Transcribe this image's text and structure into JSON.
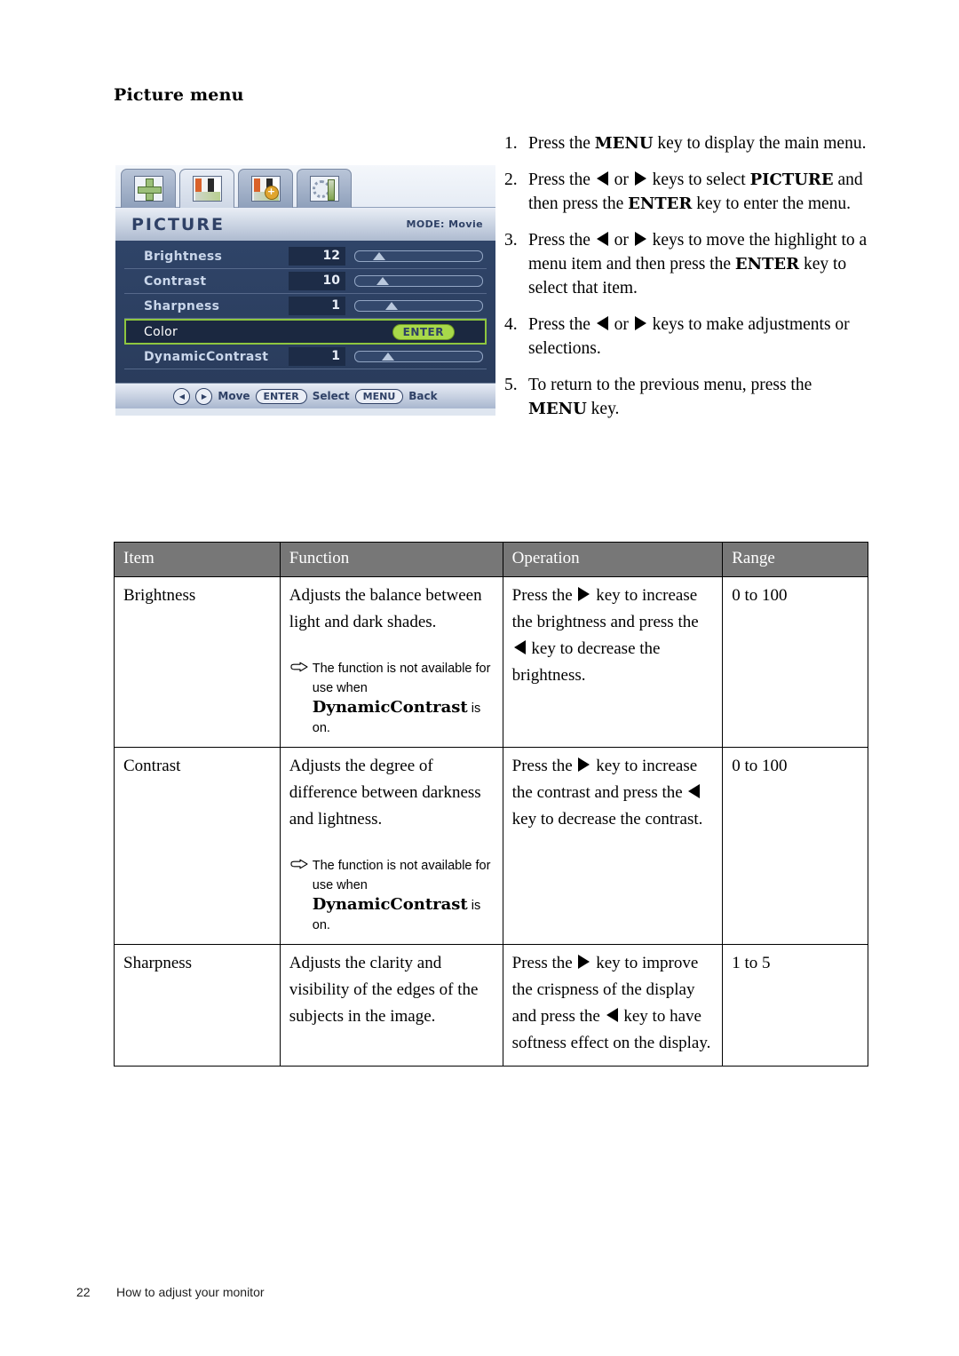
{
  "page": {
    "heading": "Picture menu",
    "footer_page_number": "22",
    "footer_text": "How to adjust your monitor"
  },
  "osd": {
    "tabs": [
      {
        "name": "display-position-tab",
        "icon": "four-way-arrows-icon"
      },
      {
        "name": "picture-tab",
        "icon": "color-bars-icon"
      },
      {
        "name": "picture-advanced-tab",
        "icon": "color-bars-plus-icon"
      },
      {
        "name": "system-tab",
        "icon": "gear-screwdriver-icon"
      }
    ],
    "title": "PICTURE",
    "mode_label": "MODE: Movie",
    "rows": [
      {
        "label": "Brightness",
        "value": "12",
        "slider_pct": 14,
        "type": "slider"
      },
      {
        "label": "Contrast",
        "value": "10",
        "slider_pct": 17,
        "type": "slider"
      },
      {
        "label": "Sharpness",
        "value": "1",
        "slider_pct": 24,
        "type": "slider"
      },
      {
        "label": "Color",
        "value": "",
        "type": "enter",
        "button_label": "ENTER",
        "highlighted": true
      },
      {
        "label": "DynamicContrast",
        "value": "1",
        "slider_pct": 21,
        "type": "slider"
      }
    ],
    "footer": {
      "move_label": "Move",
      "enter_label": "ENTER",
      "select_label": "Select",
      "menu_label": "MENU",
      "back_label": "Back"
    },
    "colors": {
      "highlight_green": "#8ec63f",
      "enter_pill": "#a8d94a",
      "body_blue": "#2f4468"
    }
  },
  "steps": [
    {
      "num": "1.",
      "parts": [
        {
          "t": "Press the "
        },
        {
          "t": "MENU",
          "b": true
        },
        {
          "t": " key to display the main menu."
        }
      ]
    },
    {
      "num": "2.",
      "parts": [
        {
          "t": "Press the "
        },
        {
          "icon": "left-arrow-icon"
        },
        {
          "t": " or "
        },
        {
          "icon": "right-arrow-icon"
        },
        {
          "t": " keys to select "
        },
        {
          "t": "PICTURE",
          "b": true
        },
        {
          "t": " and then press the "
        },
        {
          "t": "ENTER",
          "b": true
        },
        {
          "t": " key to enter the menu."
        }
      ]
    },
    {
      "num": "3.",
      "parts": [
        {
          "t": "Press the "
        },
        {
          "icon": "left-arrow-icon"
        },
        {
          "t": " or "
        },
        {
          "icon": "right-arrow-icon"
        },
        {
          "t": " keys to move the highlight to a menu item and then press the "
        },
        {
          "t": "ENTER",
          "b": true
        },
        {
          "t": " key to select that item."
        }
      ]
    },
    {
      "num": "4.",
      "parts": [
        {
          "t": "Press the "
        },
        {
          "icon": "left-arrow-icon"
        },
        {
          "t": " or "
        },
        {
          "icon": "right-arrow-icon"
        },
        {
          "t": " keys to make adjustments or selections."
        }
      ]
    },
    {
      "num": "5.",
      "parts": [
        {
          "t": "To return to the previous menu, press the "
        },
        {
          "t": "MENU",
          "b": true
        },
        {
          "t": " key."
        }
      ]
    }
  ],
  "table": {
    "headers": [
      "Item",
      "Function",
      "Operation",
      "Range"
    ],
    "rows": [
      {
        "item": "Brightness",
        "function": "Adjusts the balance between light and dark shades.",
        "note": {
          "icon": "pointing-hand-icon",
          "parts": [
            {
              "t": "The function is not available for use when "
            },
            {
              "t": "DynamicContrast",
              "b": true
            },
            {
              "t": " is on."
            }
          ]
        },
        "operation_parts": [
          {
            "t": "Press the "
          },
          {
            "icon": "right-arrow-icon"
          },
          {
            "t": " key to increase the brightness and press the "
          },
          {
            "icon": "left-arrow-icon"
          },
          {
            "t": " key to decrease the brightness."
          }
        ],
        "range": "0 to 100"
      },
      {
        "item": "Contrast",
        "function": "Adjusts the degree of difference between darkness and lightness.",
        "note": {
          "icon": "pointing-hand-icon",
          "parts": [
            {
              "t": "The function is not available for use when "
            },
            {
              "t": "DynamicContrast",
              "b": true
            },
            {
              "t": " is on."
            }
          ]
        },
        "operation_parts": [
          {
            "t": "Press the "
          },
          {
            "icon": "right-arrow-icon"
          },
          {
            "t": " key to increase the contrast and press the "
          },
          {
            "icon": "left-arrow-icon"
          },
          {
            "t": " key to decrease the contrast."
          }
        ],
        "range": "0 to 100"
      },
      {
        "item": "Sharpness",
        "function": "Adjusts the clarity and visibility of the edges of the subjects in the image.",
        "note": null,
        "operation_parts": [
          {
            "t": "Press the "
          },
          {
            "icon": "right-arrow-icon"
          },
          {
            "t": " key to improve the crispness of the display and press the "
          },
          {
            "icon": "left-arrow-icon"
          },
          {
            "t": " key to have softness effect on the display."
          }
        ],
        "range": "1 to 5"
      }
    ]
  }
}
